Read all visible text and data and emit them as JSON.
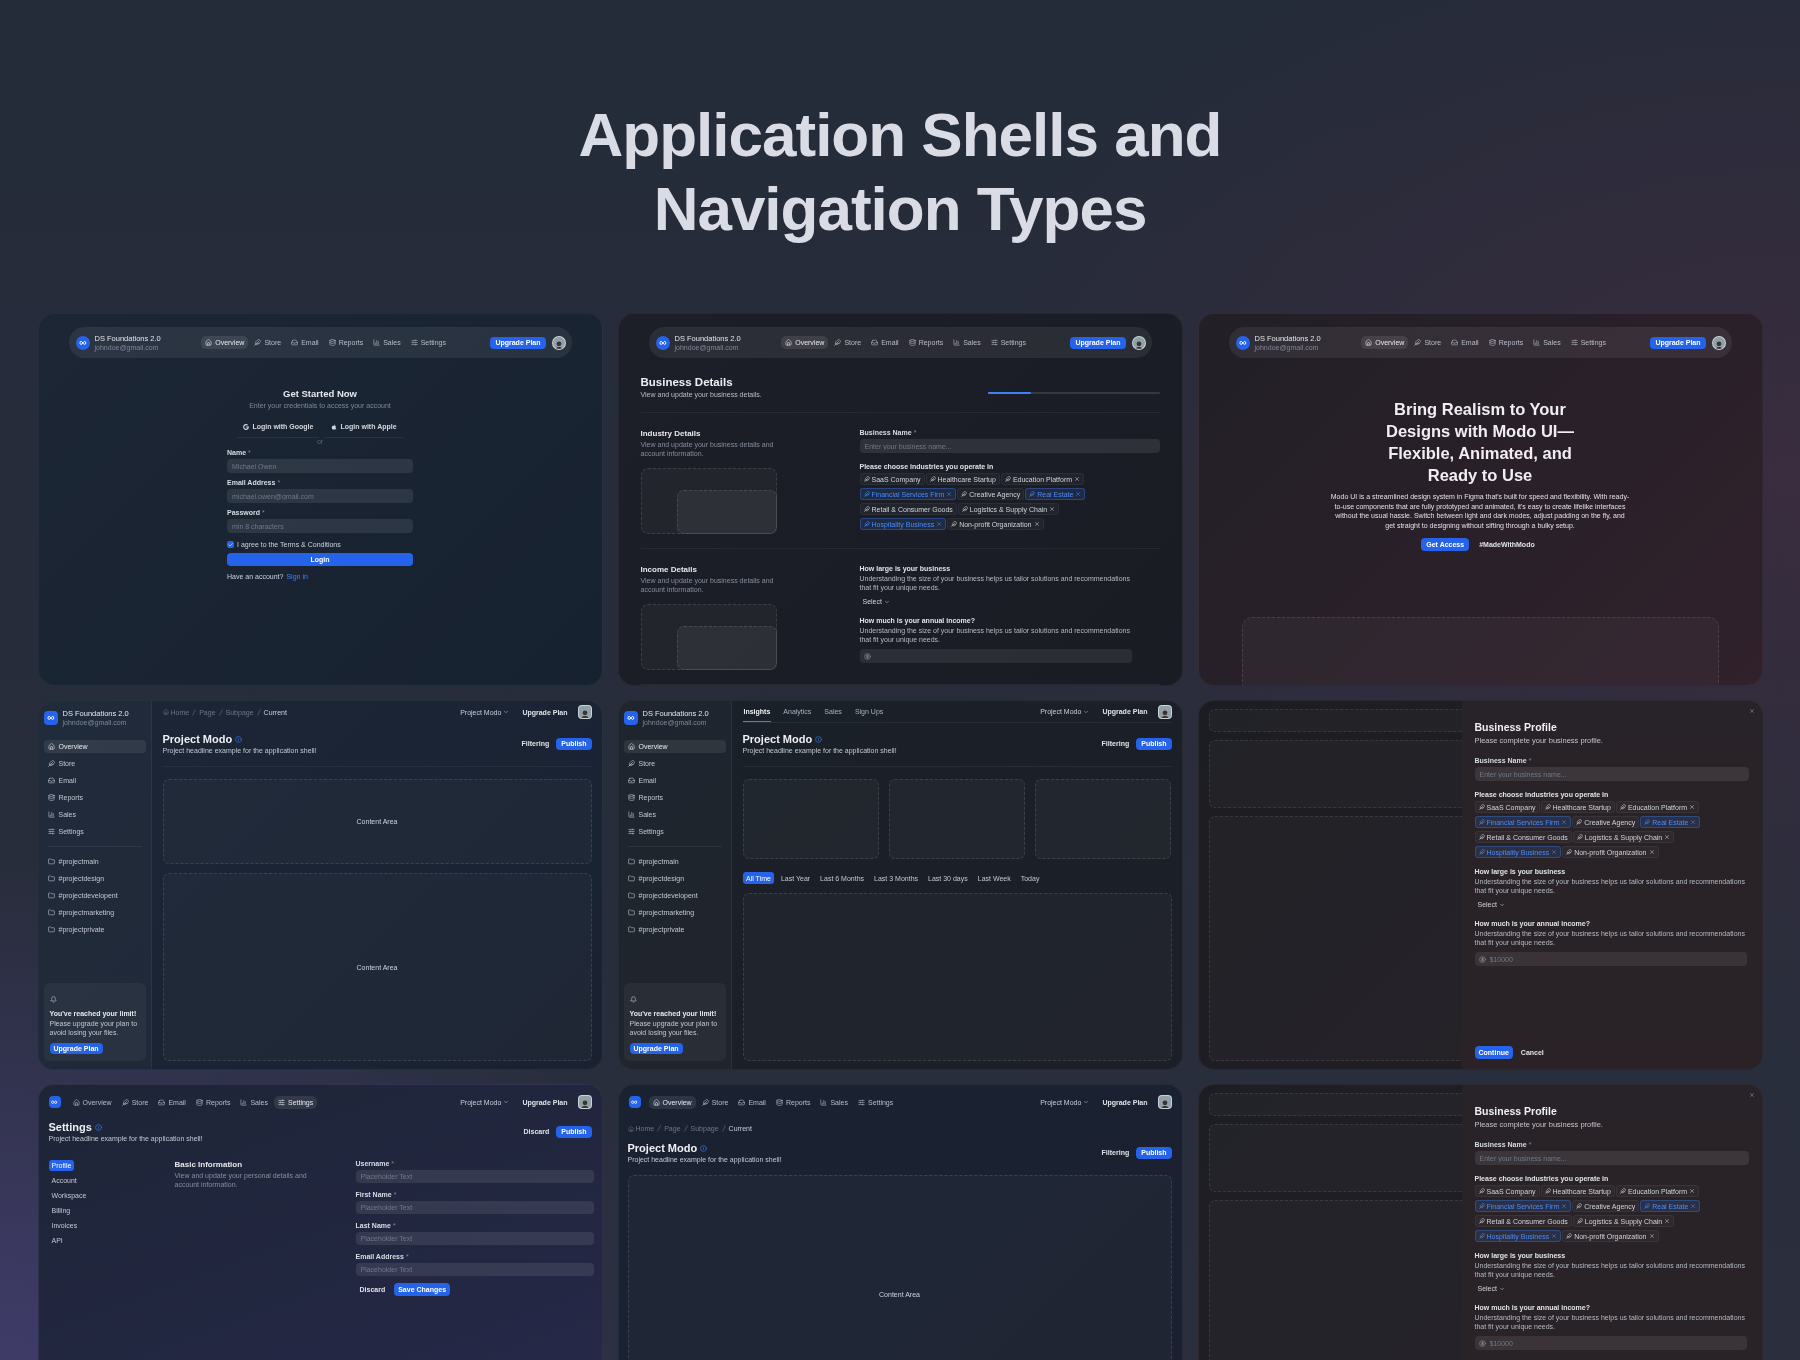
{
  "heading": "Application Shells and Navigation Types",
  "panels": [
    {
      "kind": "login",
      "topbar": {
        "brand": "DS Foundations 2.0",
        "email": "johndoe@gmail.com",
        "nav": [
          {
            "label": "Overview",
            "selected": true
          },
          {
            "label": "Store",
            "selected": false
          },
          {
            "label": "Email",
            "selected": false
          },
          {
            "label": "Reports",
            "selected": false
          },
          {
            "label": "Sales",
            "selected": false
          },
          {
            "label": "Settings",
            "selected": false
          }
        ],
        "upgrade": "Upgrade Plan"
      },
      "form": {
        "title": "Get Started Now",
        "subtitle": "Enter your credentials to access your account",
        "social": [
          "Login with Google",
          "Login with Apple"
        ],
        "divider": "or",
        "fields": [
          {
            "label": "Name",
            "mark": "*",
            "placeholder": "Michael Owen"
          },
          {
            "label": "Email Address",
            "mark": "*",
            "placeholder": "michael.owen@gmail.com"
          },
          {
            "label": "Password",
            "mark": "*",
            "placeholder": "min 8 characters"
          }
        ],
        "agree": {
          "label": "I agree to the Terms & Conditions",
          "checked": true
        },
        "submit": "Login",
        "footer": "Have an account?",
        "link": "Sign in"
      }
    },
    {
      "kind": "business_details",
      "topbar": {
        "brand": "DS Foundations 2.0",
        "email": "johndoe@gmail.com",
        "nav": [
          {
            "label": "Overview",
            "selected": true
          },
          {
            "label": "Store",
            "selected": false
          },
          {
            "label": "Email",
            "selected": false
          },
          {
            "label": "Reports",
            "selected": false
          },
          {
            "label": "Sales",
            "selected": false
          },
          {
            "label": "Settings",
            "selected": false
          }
        ],
        "upgrade": "Upgrade Plan"
      },
      "title": "Business Details",
      "subtitle": "View and update your business details.",
      "progress": {
        "level": 0.25
      },
      "sections": [
        {
          "title": "Industry Details",
          "description": "View and update your business details and account information.",
          "blocks": [
            {
              "kind": "text_field",
              "label": "Business Name",
              "mark": "*",
              "placeholder": "Enter your business name..."
            },
            {
              "kind": "chips",
              "label": "Please choose industries you operate in",
              "rows": [
                [
                  {
                    "label": "SaaS Company",
                    "selected": false,
                    "removable": false
                  },
                  {
                    "label": "Healthcare Startup",
                    "selected": false,
                    "removable": false
                  },
                  {
                    "label": "Education Platform",
                    "selected": false,
                    "removable": true
                  }
                ],
                [
                  {
                    "label": "Financial Services Firm",
                    "selected": true,
                    "removable": true
                  },
                  {
                    "label": "Creative Agency",
                    "selected": false,
                    "removable": false
                  },
                  {
                    "label": "Real Estate",
                    "selected": true,
                    "removable": true
                  }
                ],
                [
                  {
                    "label": "Retail & Consumer Goods",
                    "selected": false,
                    "removable": false
                  },
                  {
                    "label": "Logistics & Supply Chain",
                    "selected": false,
                    "removable": true
                  }
                ],
                [
                  {
                    "label": "Hospitality Business",
                    "selected": true,
                    "removable": true
                  },
                  {
                    "label": "Non-profit Organization",
                    "selected": false,
                    "removable": true
                  }
                ]
              ]
            }
          ]
        },
        {
          "title": "Income Details",
          "description": "View and update your business details and account information.",
          "blocks": [
            {
              "kind": "select",
              "label": "How large is your business",
              "description": "Understanding the size of your business helps us tailor solutions and recommendations that fit your unique needs.",
              "value": "Select"
            },
            {
              "kind": "input",
              "label": "How much is your annual income?",
              "description": "Understanding the size of your business helps us tailor solutions and recommendations that fit your unique needs."
            }
          ]
        }
      ]
    },
    {
      "kind": "hero",
      "topbar": {
        "brand": "DS Foundations 2.0",
        "email": "johndoe@gmail.com",
        "nav": [
          {
            "label": "Overview",
            "selected": true
          },
          {
            "label": "Store",
            "selected": false
          },
          {
            "label": "Email",
            "selected": false
          },
          {
            "label": "Reports",
            "selected": false
          },
          {
            "label": "Sales",
            "selected": false
          },
          {
            "label": "Settings",
            "selected": false
          }
        ],
        "upgrade": "Upgrade Plan"
      },
      "headline": "Bring Realism to Your Designs with Modo UI—Flexible, Animated, and Ready to Use",
      "body": "Modo UI is a streamlined design system in Figma that's built for speed and flexibility. With ready-to-use components that are fully prototyped and animated, it's easy to create lifelike interfaces without the usual hassle. Switch between light and dark modes, adjust padding on the fly, and get straight to designing without sifting through a bulky setup.",
      "primary": "Get Access",
      "secondary": "#MadeWithModo"
    },
    {
      "kind": "sidebar_shell",
      "sidebar": {
        "brand": "DS Foundations 2.0",
        "email": "johndoe@gmail.com",
        "nav": [
          {
            "label": "Overview",
            "selected": true
          },
          {
            "label": "Store",
            "selected": false
          },
          {
            "label": "Email",
            "selected": false
          },
          {
            "label": "Reports",
            "selected": false
          },
          {
            "label": "Sales",
            "selected": false
          },
          {
            "label": "Settings",
            "selected": false
          }
        ],
        "channels": [
          "#projectmain",
          "#projectdesign",
          "#projectdevelopent",
          "#projectmarketing",
          "#projectprivate"
        ],
        "promo": {
          "title": "You've reached your limit!",
          "text": "Please upgrade your plan to avoid losing your files.",
          "button": "Upgrade Plan"
        }
      },
      "header": {
        "breadcrumbs": [
          {
            "label": "Home",
            "selected": false
          },
          {
            "label": "Page",
            "selected": false
          },
          {
            "label": "Subpage",
            "selected": false
          },
          {
            "label": "Current",
            "selected": true
          }
        ],
        "project": "Project Modo",
        "upgrade": "Upgrade Plan"
      },
      "title": "Project Modo",
      "subtitle": "Project headline example for the application shell!",
      "actions": {
        "secondary": "Filtering",
        "primary": "Publish"
      },
      "content": [
        {
          "kind": "area",
          "label": "Content Area"
        },
        {
          "kind": "area",
          "label": "Content Area"
        }
      ]
    },
    {
      "kind": "sidebar_shell",
      "sidebar": {
        "brand": "DS Foundations 2.0",
        "email": "johndoe@gmail.com",
        "nav": [
          {
            "label": "Overview",
            "selected": true
          },
          {
            "label": "Store",
            "selected": false
          },
          {
            "label": "Email",
            "selected": false
          },
          {
            "label": "Reports",
            "selected": false
          },
          {
            "label": "Sales",
            "selected": false
          },
          {
            "label": "Settings",
            "selected": false
          }
        ],
        "channels": [
          "#projectmain",
          "#projectdesign",
          "#projectdevelopent",
          "#projectmarketing",
          "#projectprivate"
        ],
        "promo": {
          "title": "You've reached your limit!",
          "text": "Please upgrade your plan to avoid losing your files.",
          "button": "Upgrade Plan"
        }
      },
      "header": {
        "tabs": [
          {
            "label": "Insights",
            "selected": true
          },
          {
            "label": "Analytics",
            "selected": false
          },
          {
            "label": "Sales",
            "selected": false
          },
          {
            "label": "Sign Ups",
            "selected": false
          }
        ],
        "project": "Project Modo",
        "upgrade": "Upgrade Plan"
      },
      "title": "Project Modo",
      "subtitle": "Project headline example for the application shell!",
      "actions": {
        "secondary": "Filtering",
        "primary": "Publish"
      },
      "content": [
        {
          "kind": "cards"
        },
        {
          "kind": "filters",
          "items": [
            {
              "label": "All Time",
              "selected": true
            },
            {
              "label": "Last Year",
              "selected": false
            },
            {
              "label": "Last 6 Months",
              "selected": false
            },
            {
              "label": "Last 3 Months",
              "selected": false
            },
            {
              "label": "Last 30 days",
              "selected": false
            },
            {
              "label": "Last Week",
              "selected": false
            },
            {
              "label": "Today",
              "selected": false
            }
          ]
        },
        {
          "kind": "area"
        }
      ]
    },
    {
      "kind": "drawer",
      "drawer": {
        "title": "Business Profile",
        "subtitle": "Please complete your business profile.",
        "blocks": [
          {
            "kind": "text_field",
            "label": "Business Name",
            "mark": "*",
            "placeholder": "Enter your business name..."
          },
          {
            "kind": "chips",
            "label": "Please choose industries you operate in",
            "rows": [
              [
                {
                  "label": "SaaS Company",
                  "selected": false,
                  "removable": false
                },
                {
                  "label": "Healthcare Startup",
                  "selected": false,
                  "removable": false
                },
                {
                  "label": "Education Platform",
                  "selected": false,
                  "removable": true
                }
              ],
              [
                {
                  "label": "Financial Services Firm",
                  "selected": true,
                  "removable": true
                },
                {
                  "label": "Creative Agency",
                  "selected": false,
                  "removable": false
                },
                {
                  "label": "Real Estate",
                  "selected": true,
                  "removable": true
                }
              ],
              [
                {
                  "label": "Retail & Consumer Goods",
                  "selected": false,
                  "removable": false
                },
                {
                  "label": "Logistics & Supply Chain",
                  "selected": false,
                  "removable": true
                }
              ],
              [
                {
                  "label": "Hospitality Business",
                  "selected": true,
                  "removable": true
                },
                {
                  "label": "Non-profit Organization",
                  "selected": false,
                  "removable": true
                }
              ]
            ]
          },
          {
            "kind": "select",
            "label": "How large is your business",
            "description": "Understanding the size of your business helps us tailor solutions and recommendations that fit your unique needs.",
            "value": "Select"
          },
          {
            "kind": "input",
            "label": "How much is your annual income?",
            "description": "Understanding the size of your business helps us tailor solutions and recommendations that fit your unique needs.",
            "placeholder": "$10000"
          }
        ],
        "actions": {
          "primary": "Continue",
          "secondary": "Cancel"
        }
      }
    },
    {
      "kind": "settings",
      "topbar": {
        "nav": [
          {
            "label": "Overview",
            "selected": false
          },
          {
            "label": "Store",
            "selected": false
          },
          {
            "label": "Email",
            "selected": false
          },
          {
            "label": "Reports",
            "selected": false
          },
          {
            "label": "Sales",
            "selected": false
          },
          {
            "label": "Settings",
            "selected": true
          }
        ],
        "project": "Project Modo",
        "upgrade": "Upgrade Plan"
      },
      "title": "Settings",
      "subtitle": "Project headline example for the application shell!",
      "actions": {
        "secondary": "Discard",
        "primary": "Publish"
      },
      "menu": [
        {
          "label": "Profile",
          "selected": true
        },
        {
          "label": "Account",
          "selected": false
        },
        {
          "label": "Workspace",
          "selected": false
        },
        {
          "label": "Billing",
          "selected": false
        },
        {
          "label": "Invoices",
          "selected": false
        },
        {
          "label": "API",
          "selected": false
        }
      ],
      "section": {
        "title": "Basic Information",
        "description": "View and update your personal details and account information."
      },
      "fields": [
        {
          "label": "Username",
          "mark": "*",
          "placeholder": "Placeholder Text"
        },
        {
          "label": "First Name",
          "mark": "*",
          "placeholder": "Placeholder Text"
        },
        {
          "label": "Last Name",
          "mark": "*",
          "placeholder": "Placeholder Text"
        },
        {
          "label": "Email Address",
          "mark": "*",
          "placeholder": "Placeholder Text"
        }
      ],
      "buttons": {
        "secondary": "Discard",
        "primary": "Save Changes"
      }
    },
    {
      "kind": "topnav_shell",
      "topbar": {
        "nav": [
          {
            "label": "Overview",
            "selected": true
          },
          {
            "label": "Store",
            "selected": false
          },
          {
            "label": "Email",
            "selected": false
          },
          {
            "label": "Reports",
            "selected": false
          },
          {
            "label": "Sales",
            "selected": false
          },
          {
            "label": "Settings",
            "selected": false
          }
        ],
        "project": "Project Modo",
        "upgrade": "Upgrade Plan"
      },
      "breadcrumbs": [
        {
          "label": "Home",
          "selected": false
        },
        {
          "label": "Page",
          "selected": false
        },
        {
          "label": "Subpage",
          "selected": false
        },
        {
          "label": "Current",
          "selected": true
        }
      ],
      "title": "Project Modo",
      "subtitle": "Project headline example for the application shell!",
      "actions": {
        "secondary": "Filtering",
        "primary": "Publish"
      },
      "content": [
        {
          "kind": "area",
          "label": "Content Area"
        }
      ]
    },
    {
      "kind": "drawer",
      "drawer": {
        "title": "Business Profile",
        "subtitle": "Please complete your business profile.",
        "blocks": [
          {
            "kind": "text_field",
            "label": "Business Name",
            "mark": "*",
            "placeholder": "Enter your business name..."
          },
          {
            "kind": "chips",
            "label": "Please choose industries you operate in",
            "rows": [
              [
                {
                  "label": "SaaS Company",
                  "selected": false,
                  "removable": false
                },
                {
                  "label": "Healthcare Startup",
                  "selected": false,
                  "removable": false
                },
                {
                  "label": "Education Platform",
                  "selected": false,
                  "removable": true
                }
              ],
              [
                {
                  "label": "Financial Services Firm",
                  "selected": true,
                  "removable": true
                },
                {
                  "label": "Creative Agency",
                  "selected": false,
                  "removable": false
                },
                {
                  "label": "Real Estate",
                  "selected": true,
                  "removable": true
                }
              ],
              [
                {
                  "label": "Retail & Consumer Goods",
                  "selected": false,
                  "removable": false
                },
                {
                  "label": "Logistics & Supply Chain",
                  "selected": false,
                  "removable": true
                }
              ],
              [
                {
                  "label": "Hospitality Business",
                  "selected": true,
                  "removable": true
                },
                {
                  "label": "Non-profit Organization",
                  "selected": false,
                  "removable": true
                }
              ]
            ]
          },
          {
            "kind": "select",
            "label": "How large is your business",
            "description": "Understanding the size of your business helps us tailor solutions and recommendations that fit your unique needs.",
            "value": "Select"
          },
          {
            "kind": "input",
            "label": "How much is your annual income?",
            "description": "Understanding the size of your business helps us tailor solutions and recommendations that fit your unique needs.",
            "placeholder": "$10000"
          }
        ]
      }
    }
  ]
}
